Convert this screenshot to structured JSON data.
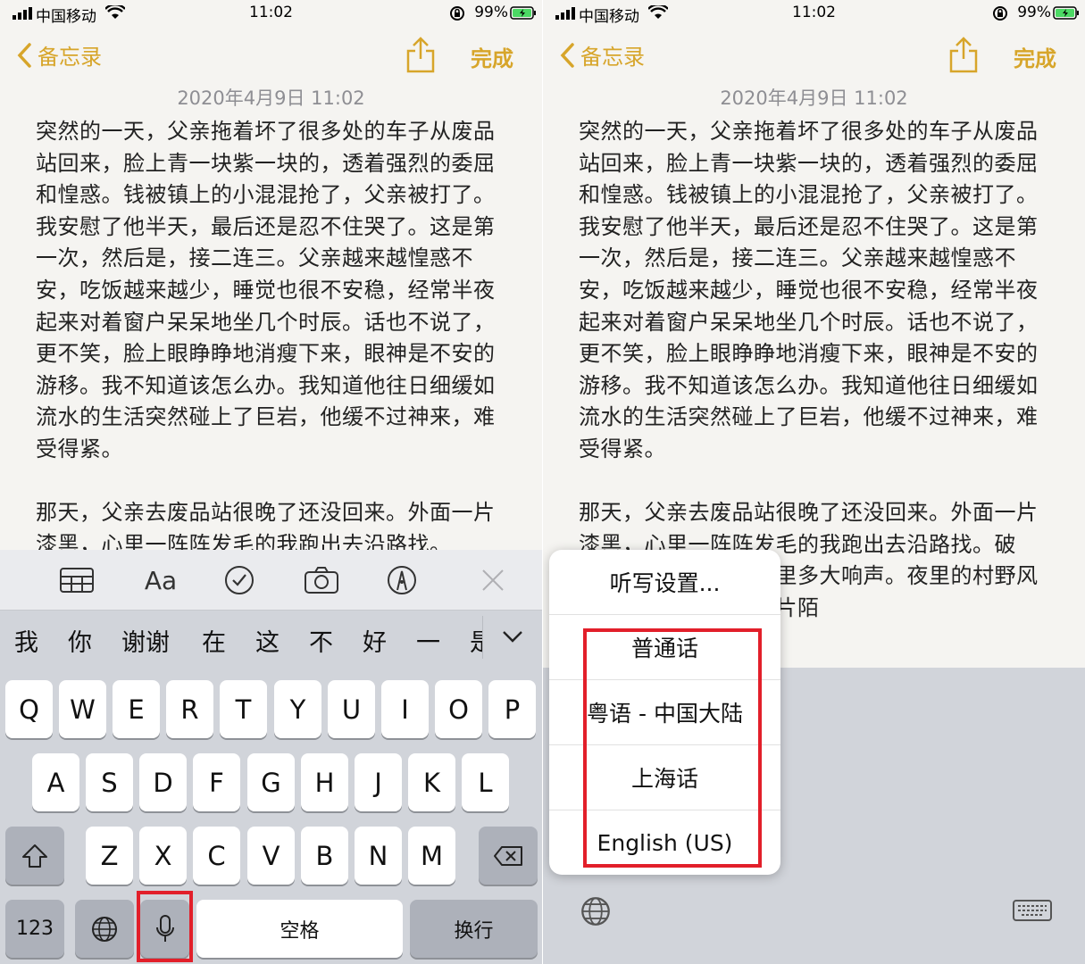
{
  "status": {
    "carrier": "中国移动",
    "time": "11:02",
    "battery": "99%"
  },
  "nav": {
    "back_label": "备忘录",
    "done_label": "完成"
  },
  "note": {
    "date": "2020年4月9日 11:02",
    "para1": "突然的一天，父亲拖着坏了很多处的车子从废品站回来，脸上青一块紫一块的，透着强烈的委屈和惶惑。钱被镇上的小混混抢了，父亲被打了。我安慰了他半天，最后还是忍不住哭了。这是第一次，然后是，接二连三。父亲越来越惶惑不安，吃饭越来越少，睡觉也很不安稳，经常半夜起来对着窗户呆呆地坐几个时辰。话也不说了，更不笑，脸上眼睁睁地消瘦下来，眼神是不安的游移。我不知道该怎么办。我知道他往日细缓如流水的生活突然碰上了巨岩，他缓不过神来，难受得紧。",
    "para2": "那天，父亲去废品站很晚了还没回来。外面一片漆黑，心里一阵阵发毛的我跑出去沿路找。",
    "para2_right": "那天，父亲去废品站很晚了还没回来。外面一片漆黑，心里一阵阵发毛的我跑出去沿路找。破锣，震得自己心里脑里多大响声。夜里的村野风声和喊声总会引来一片陌"
  },
  "keyboard": {
    "candidates": [
      "我",
      "你",
      "谢谢",
      "在",
      "这",
      "不",
      "好",
      "一",
      "是"
    ],
    "row1": [
      "Q",
      "W",
      "E",
      "R",
      "T",
      "Y",
      "U",
      "I",
      "O",
      "P"
    ],
    "row2": [
      "A",
      "S",
      "D",
      "F",
      "G",
      "H",
      "J",
      "K",
      "L"
    ],
    "row3": [
      "Z",
      "X",
      "C",
      "V",
      "B",
      "N",
      "M"
    ],
    "numbers_label": "123",
    "space_label": "空格",
    "return_label": "换行"
  },
  "dictation_menu": {
    "settings_label": "听写设置...",
    "languages": [
      "普通话",
      "粤语 - 中国大陆",
      "上海话",
      "English (US)"
    ]
  },
  "colors": {
    "accent": "#d7a52a",
    "highlight": "#e21f2a"
  }
}
